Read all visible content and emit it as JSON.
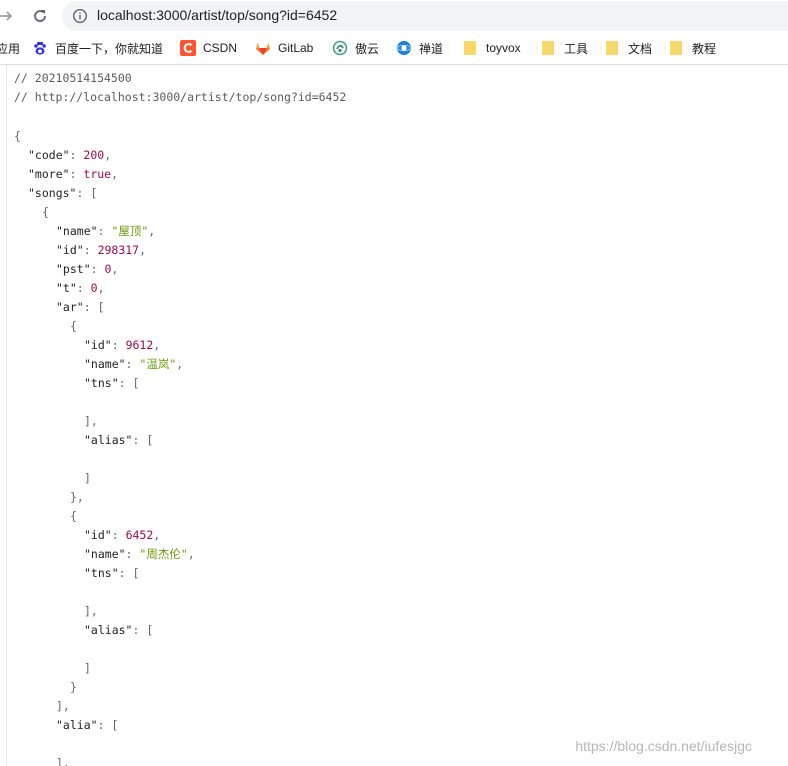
{
  "browser": {
    "address_bar": {
      "url": "localhost:3000/artist/top/song?id=6452"
    },
    "bookmarks": [
      {
        "label": "应用",
        "icon": "apps-icon"
      },
      {
        "label": "百度一下，你就知道",
        "icon": "baidu-paw-icon"
      },
      {
        "label": "CSDN",
        "icon": "csdn-icon"
      },
      {
        "label": "GitLab",
        "icon": "gitlab-icon"
      },
      {
        "label": "傲云",
        "icon": "aoyun-icon"
      },
      {
        "label": "禅道",
        "icon": "zentao-icon"
      },
      {
        "label": "toyvox",
        "icon": "folder-icon"
      },
      {
        "label": "工具",
        "icon": "folder-icon"
      },
      {
        "label": "文档",
        "icon": "folder-icon"
      },
      {
        "label": "教程",
        "icon": "folder-icon"
      }
    ]
  },
  "json_viewer": {
    "comments": [
      "// 20210514154500",
      "// http://localhost:3000/artist/top/song?id=6452"
    ],
    "lines": [
      {
        "indent": 0,
        "parts": [
          {
            "c": "p",
            "t": "{"
          }
        ]
      },
      {
        "indent": 1,
        "parts": [
          {
            "c": "k",
            "t": "\"code\""
          },
          {
            "c": "p",
            "t": ": "
          },
          {
            "c": "n",
            "t": "200"
          },
          {
            "c": "p",
            "t": ","
          }
        ]
      },
      {
        "indent": 1,
        "parts": [
          {
            "c": "k",
            "t": "\"more\""
          },
          {
            "c": "p",
            "t": ": "
          },
          {
            "c": "b",
            "t": "true"
          },
          {
            "c": "p",
            "t": ","
          }
        ]
      },
      {
        "indent": 1,
        "parts": [
          {
            "c": "k",
            "t": "\"songs\""
          },
          {
            "c": "p",
            "t": ": ["
          }
        ]
      },
      {
        "indent": 2,
        "parts": [
          {
            "c": "p",
            "t": "{"
          }
        ]
      },
      {
        "indent": 3,
        "parts": [
          {
            "c": "k",
            "t": "\"name\""
          },
          {
            "c": "p",
            "t": ": "
          },
          {
            "c": "s",
            "t": "\"屋顶\""
          },
          {
            "c": "p",
            "t": ","
          }
        ]
      },
      {
        "indent": 3,
        "parts": [
          {
            "c": "k",
            "t": "\"id\""
          },
          {
            "c": "p",
            "t": ": "
          },
          {
            "c": "n",
            "t": "298317"
          },
          {
            "c": "p",
            "t": ","
          }
        ]
      },
      {
        "indent": 3,
        "parts": [
          {
            "c": "k",
            "t": "\"pst\""
          },
          {
            "c": "p",
            "t": ": "
          },
          {
            "c": "n",
            "t": "0"
          },
          {
            "c": "p",
            "t": ","
          }
        ]
      },
      {
        "indent": 3,
        "parts": [
          {
            "c": "k",
            "t": "\"t\""
          },
          {
            "c": "p",
            "t": ": "
          },
          {
            "c": "n",
            "t": "0"
          },
          {
            "c": "p",
            "t": ","
          }
        ]
      },
      {
        "indent": 3,
        "parts": [
          {
            "c": "k",
            "t": "\"ar\""
          },
          {
            "c": "p",
            "t": ": ["
          }
        ]
      },
      {
        "indent": 4,
        "parts": [
          {
            "c": "p",
            "t": "{"
          }
        ]
      },
      {
        "indent": 5,
        "parts": [
          {
            "c": "k",
            "t": "\"id\""
          },
          {
            "c": "p",
            "t": ": "
          },
          {
            "c": "n",
            "t": "9612"
          },
          {
            "c": "p",
            "t": ","
          }
        ]
      },
      {
        "indent": 5,
        "parts": [
          {
            "c": "k",
            "t": "\"name\""
          },
          {
            "c": "p",
            "t": ": "
          },
          {
            "c": "s",
            "t": "\"温岚\""
          },
          {
            "c": "p",
            "t": ","
          }
        ]
      },
      {
        "indent": 5,
        "parts": [
          {
            "c": "k",
            "t": "\"tns\""
          },
          {
            "c": "p",
            "t": ": ["
          }
        ]
      },
      {
        "indent": 5,
        "parts": []
      },
      {
        "indent": 5,
        "parts": [
          {
            "c": "p",
            "t": "],"
          }
        ]
      },
      {
        "indent": 5,
        "parts": [
          {
            "c": "k",
            "t": "\"alias\""
          },
          {
            "c": "p",
            "t": ": ["
          }
        ]
      },
      {
        "indent": 5,
        "parts": []
      },
      {
        "indent": 5,
        "parts": [
          {
            "c": "p",
            "t": "]"
          }
        ]
      },
      {
        "indent": 4,
        "parts": [
          {
            "c": "p",
            "t": "},"
          }
        ]
      },
      {
        "indent": 4,
        "parts": [
          {
            "c": "p",
            "t": "{"
          }
        ]
      },
      {
        "indent": 5,
        "parts": [
          {
            "c": "k",
            "t": "\"id\""
          },
          {
            "c": "p",
            "t": ": "
          },
          {
            "c": "n",
            "t": "6452"
          },
          {
            "c": "p",
            "t": ","
          }
        ]
      },
      {
        "indent": 5,
        "parts": [
          {
            "c": "k",
            "t": "\"name\""
          },
          {
            "c": "p",
            "t": ": "
          },
          {
            "c": "s",
            "t": "\"周杰伦\""
          },
          {
            "c": "p",
            "t": ","
          }
        ]
      },
      {
        "indent": 5,
        "parts": [
          {
            "c": "k",
            "t": "\"tns\""
          },
          {
            "c": "p",
            "t": ": ["
          }
        ]
      },
      {
        "indent": 5,
        "parts": []
      },
      {
        "indent": 5,
        "parts": [
          {
            "c": "p",
            "t": "],"
          }
        ]
      },
      {
        "indent": 5,
        "parts": [
          {
            "c": "k",
            "t": "\"alias\""
          },
          {
            "c": "p",
            "t": ": ["
          }
        ]
      },
      {
        "indent": 5,
        "parts": []
      },
      {
        "indent": 5,
        "parts": [
          {
            "c": "p",
            "t": "]"
          }
        ]
      },
      {
        "indent": 4,
        "parts": [
          {
            "c": "p",
            "t": "}"
          }
        ]
      },
      {
        "indent": 3,
        "parts": [
          {
            "c": "p",
            "t": "],"
          }
        ]
      },
      {
        "indent": 3,
        "parts": [
          {
            "c": "k",
            "t": "\"alia\""
          },
          {
            "c": "p",
            "t": ": ["
          }
        ]
      },
      {
        "indent": 3,
        "parts": []
      },
      {
        "indent": 3,
        "parts": [
          {
            "c": "p",
            "t": "],"
          }
        ]
      }
    ]
  },
  "watermark": "https://blog.csdn.net/iufesjgc",
  "colors": {
    "string": "#6c9b0d",
    "number": "#9b0b4a",
    "csdn_brand": "#fc5531",
    "folder": "#f8d769"
  }
}
